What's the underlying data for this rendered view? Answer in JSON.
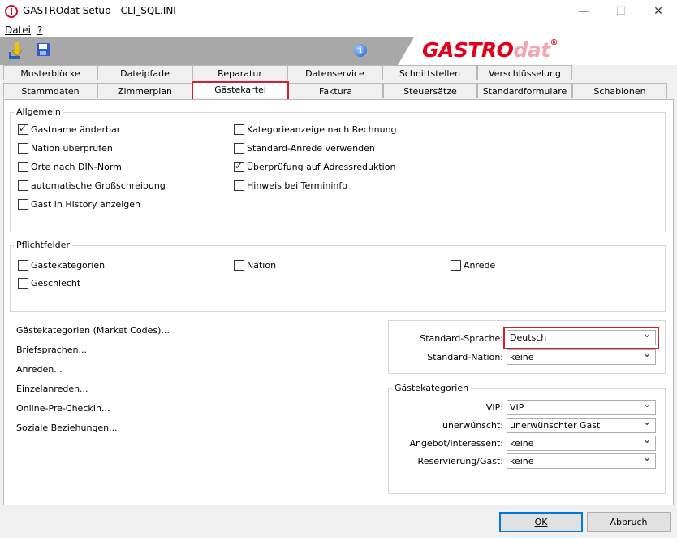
{
  "window": {
    "title": "GASTROdat Setup - CLI_SQL.INI",
    "minimize": "—",
    "maximize": "☐",
    "close": "✕"
  },
  "menu": {
    "file": "Datei",
    "help": "?"
  },
  "toolbar": {
    "info": "i",
    "logo_main": "GASTRO",
    "logo_dat": "dat",
    "logo_reg": "®"
  },
  "tabs_row1": [
    "Musterblöcke",
    "Dateipfade",
    "Reparatur",
    "Datenservice",
    "Schnittstellen",
    "Verschlüsselung"
  ],
  "tabs_row2": [
    "Stammdaten",
    "Zimmerplan",
    "Gästekartei",
    "Faktura",
    "Steuersätze",
    "Standardformulare",
    "Schablonen"
  ],
  "allgemein": {
    "legend": "Allgemein",
    "left": [
      {
        "label": "Gastname änderbar",
        "checked": true
      },
      {
        "label": "Nation überprüfen",
        "checked": false
      },
      {
        "label": "Orte nach DIN-Norm",
        "checked": false
      },
      {
        "label": "automatische Großschreibung",
        "checked": false
      },
      {
        "label": "Gast in History anzeigen",
        "checked": false
      }
    ],
    "right": [
      {
        "label": "Kategorieanzeige nach Rechnung",
        "checked": false
      },
      {
        "label": "Standard-Anrede verwenden",
        "checked": false
      },
      {
        "label": "Überprüfung auf Adressreduktion",
        "checked": true
      },
      {
        "label": "Hinweis bei Termininfo",
        "checked": false
      }
    ]
  },
  "pflichtfelder": {
    "legend": "Pflichtfelder",
    "items": [
      {
        "label": "Gästekategorien",
        "checked": false
      },
      {
        "label": "Nation",
        "checked": false
      },
      {
        "label": "Anrede",
        "checked": false
      },
      {
        "label": "Geschlecht",
        "checked": false
      }
    ]
  },
  "links": [
    "Gästekategorien (Market Codes)...",
    "Briefsprachen...",
    "Anreden...",
    "Einzelanreden...",
    "Online-Pre-CheckIn...",
    "Soziale Beziehungen..."
  ],
  "sprache": {
    "standard_sprache_label": "Standard-Sprache:",
    "standard_sprache_value": "Deutsch",
    "standard_nation_label": "Standard-Nation:",
    "standard_nation_value": "keine"
  },
  "gastkategorien": {
    "legend": "Gästekategorien",
    "rows": [
      {
        "label": "VIP:",
        "value": "VIP"
      },
      {
        "label": "unerwünscht:",
        "value": "unerwünschter Gast"
      },
      {
        "label": "Angebot/Interessent:",
        "value": "keine"
      },
      {
        "label": "Reservierung/Gast:",
        "value": "keine"
      }
    ]
  },
  "buttons": {
    "ok": "OK",
    "cancel": "Abbruch"
  },
  "colors": {
    "highlight": "#d3202e",
    "logo": "#e2001a",
    "default_button_border": "#0078d7"
  }
}
